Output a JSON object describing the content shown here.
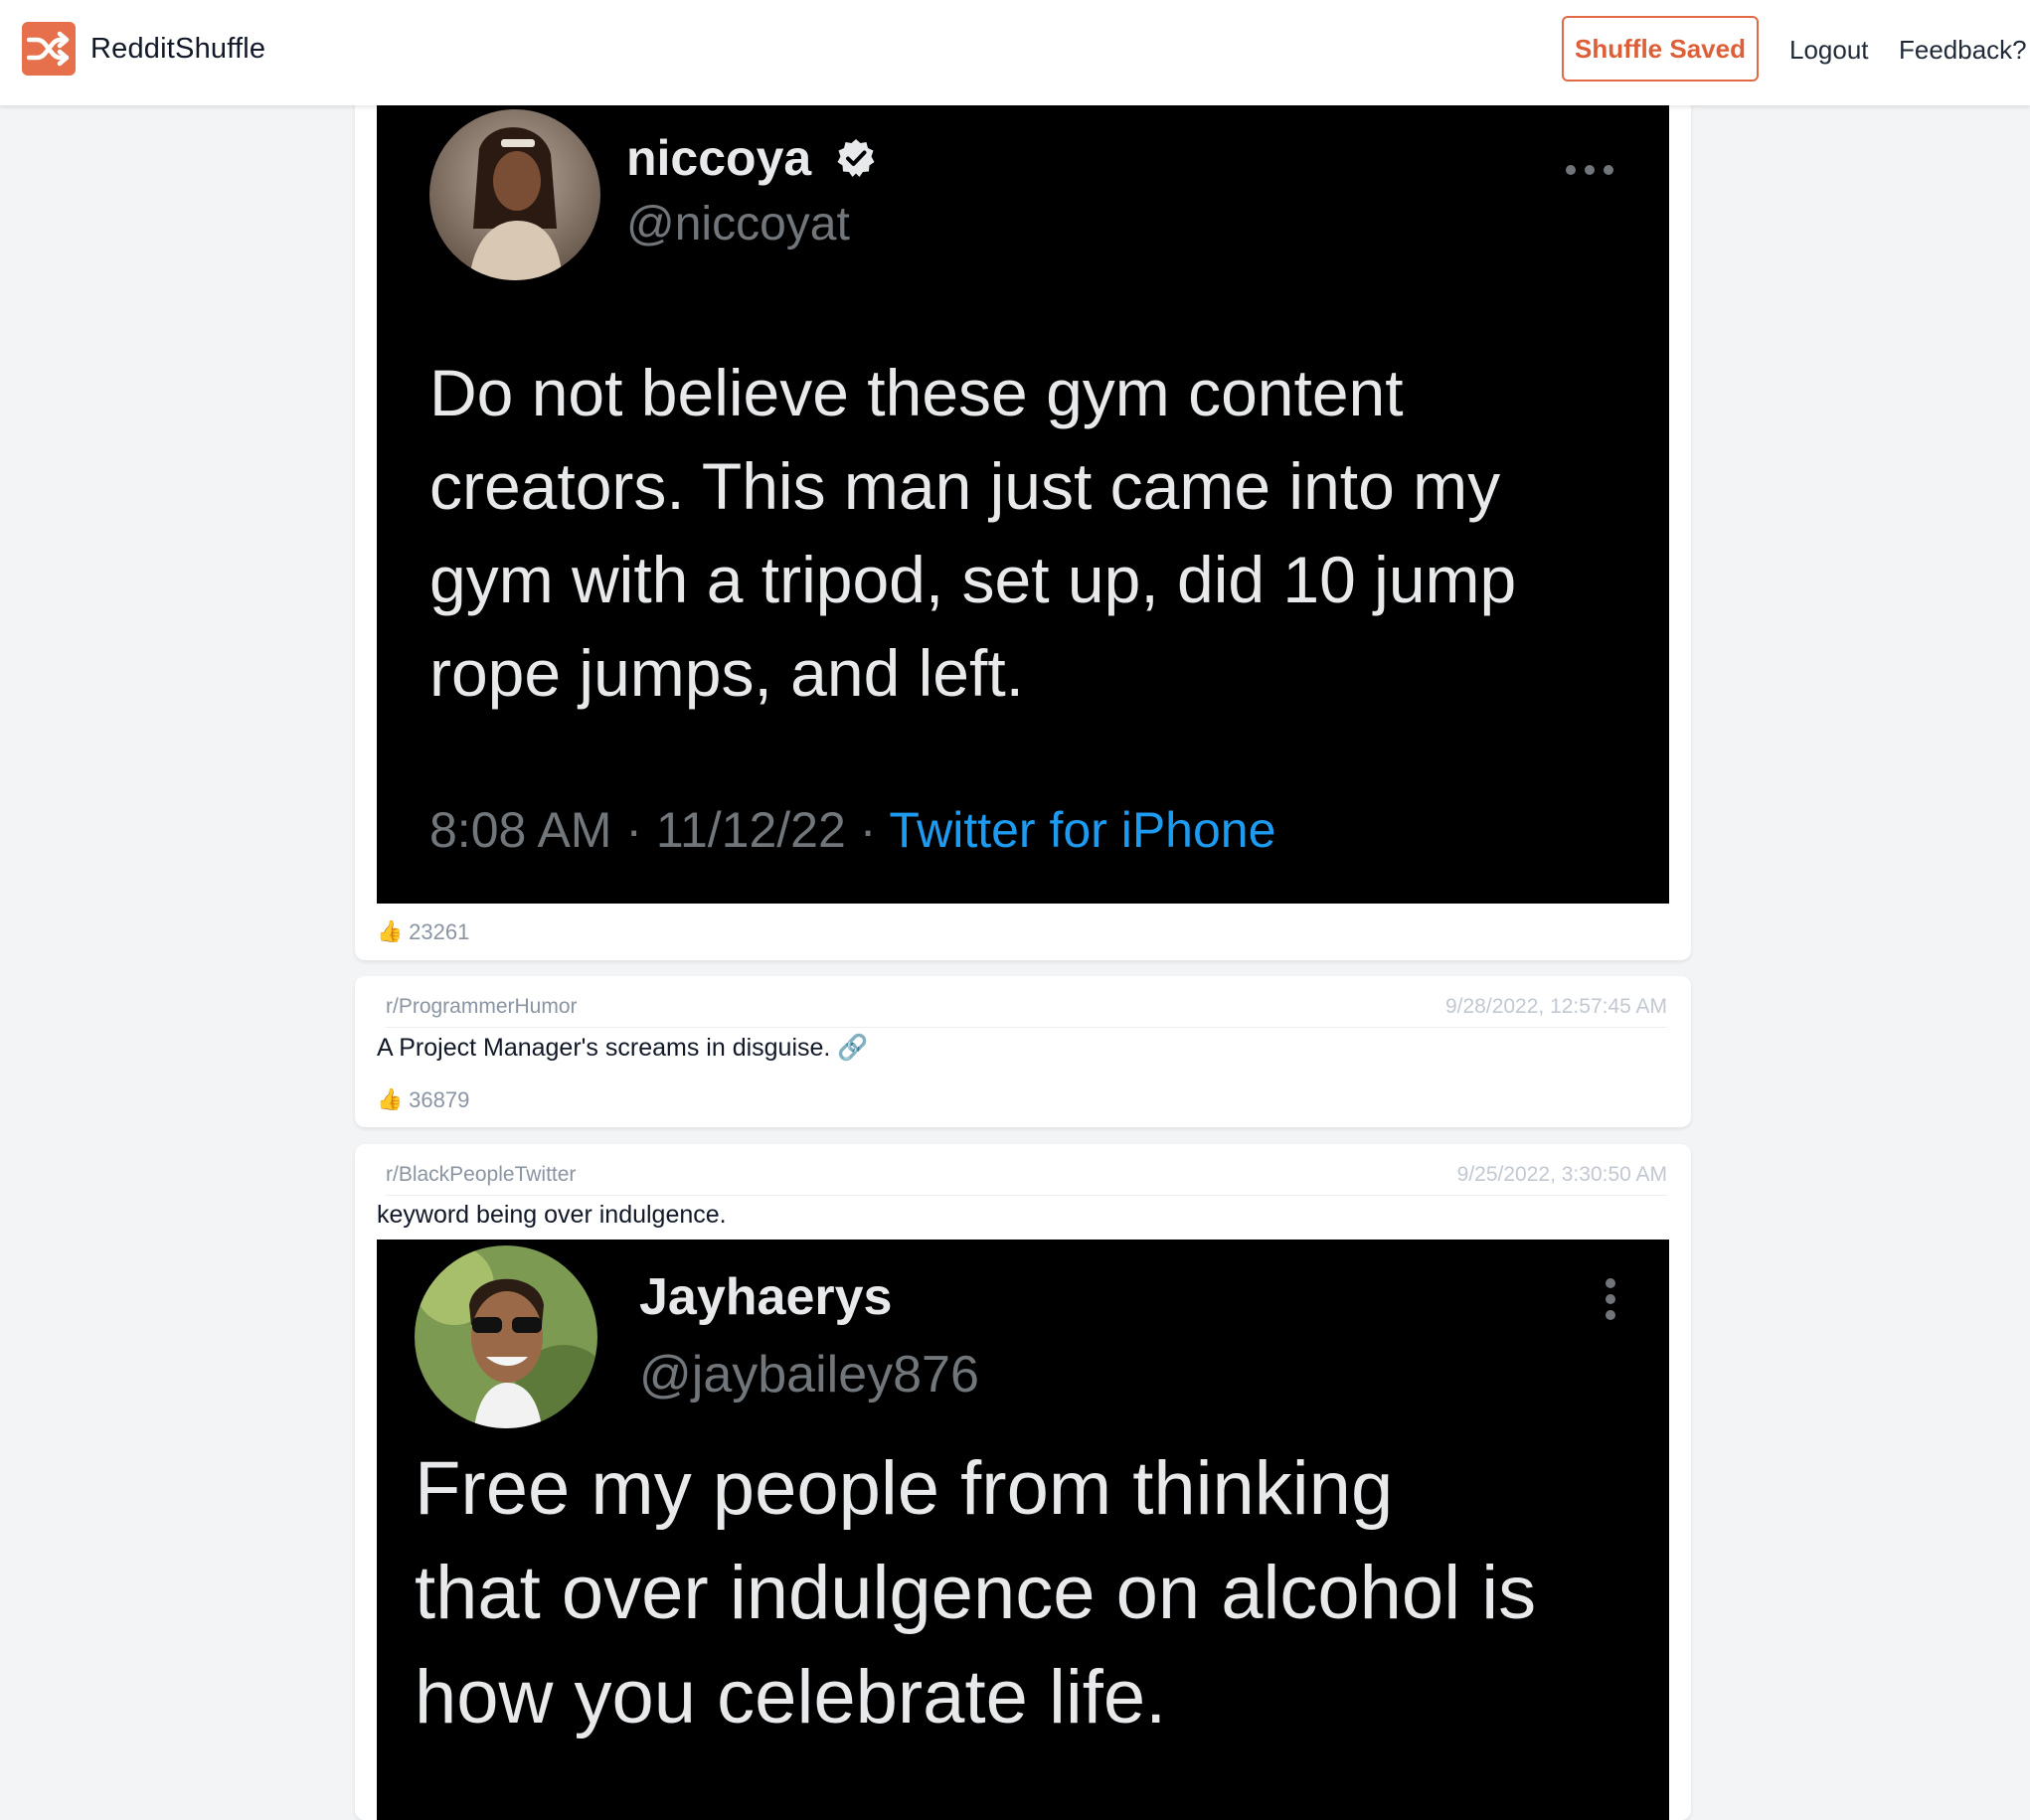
{
  "navbar": {
    "brand": "RedditShuffle",
    "shuffle_button": "Shuffle Saved",
    "logout": "Logout",
    "feedback": "Feedback?"
  },
  "posts": [
    {
      "votes": "23261",
      "image": {
        "name": "niccoya",
        "handle": "@niccoyat",
        "text_lines": [
          "Do not believe these gym content",
          "creators. This man just came into my",
          "gym with a tripod, set up, did 10 jump",
          "rope jumps, and left."
        ],
        "timestamp": "8:08 AM · 11/12/22 · ",
        "source": "Twitter for iPhone"
      }
    },
    {
      "subreddit": "r/ProgrammerHumor",
      "timestamp": "9/28/2022, 12:57:45 AM",
      "title": "A Project Manager's screams in disguise. 🔗",
      "votes": "36879"
    },
    {
      "subreddit": "r/BlackPeopleTwitter",
      "timestamp": "9/25/2022, 3:30:50 AM",
      "title": "keyword being over indulgence.",
      "image": {
        "name": "Jayhaerys",
        "handle": "@jaybailey876",
        "text_lines": [
          "Free my people from thinking",
          "that over indulgence on alcohol is",
          "how you celebrate life."
        ]
      }
    }
  ],
  "colors": {
    "accent": "#e5704b",
    "accent_text": "#dd5f38",
    "link_blue": "#1d9bf0",
    "page_bg": "#f3f4f6"
  },
  "icons": [
    "shuffle-icon",
    "thumbs-up-icon",
    "verified-badge-icon",
    "more-horizontal-icon",
    "more-vertical-icon",
    "link-icon"
  ]
}
